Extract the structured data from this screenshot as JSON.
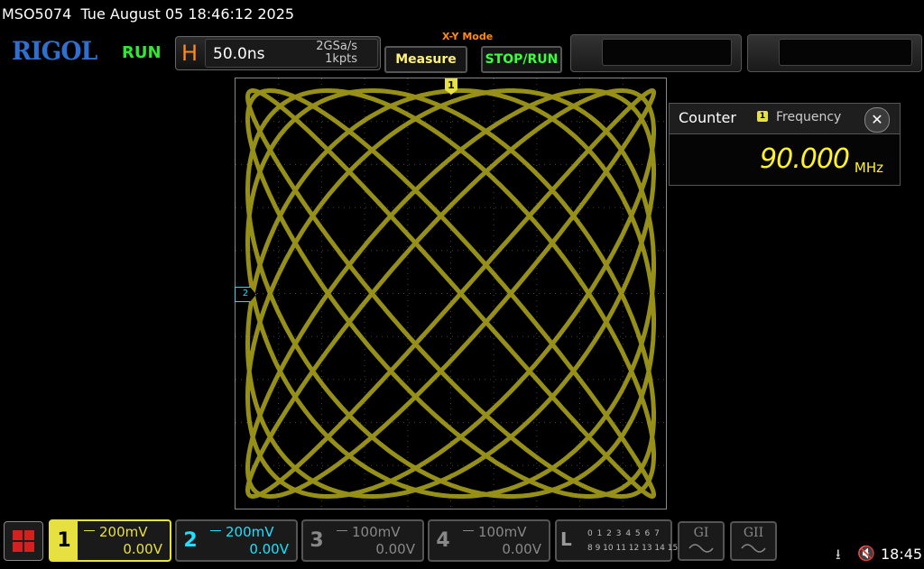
{
  "status": {
    "model": "MSO5074",
    "datetime": "Tue August 05 18:46:12 2025"
  },
  "brand": "RIGOL",
  "run_state": "RUN",
  "horizontal": {
    "letter": "H",
    "timebase": "50.0ns",
    "sample_rate": "2GSa/s",
    "memory_depth": "1kpts"
  },
  "mode_label": "X-Y Mode",
  "buttons": {
    "measure": "Measure",
    "stop_run": "STOP/RUN"
  },
  "markers": {
    "trigger": "1",
    "ch2": "2"
  },
  "counter": {
    "title": "Counter",
    "channel": "1",
    "label": "Frequency",
    "value": "90.000",
    "unit": "MHz",
    "close": "✕"
  },
  "channels": [
    {
      "num": "1",
      "scale": "200mV",
      "offset": "0.00V",
      "color": "#e6e040"
    },
    {
      "num": "2",
      "scale": "200mV",
      "offset": "0.00V",
      "color": "#20e0ff"
    },
    {
      "num": "3",
      "scale": "100mV",
      "offset": "0.00V",
      "color": "#888888"
    },
    {
      "num": "4",
      "scale": "100mV",
      "offset": "0.00V",
      "color": "#888888"
    }
  ],
  "logic": {
    "letter": "L",
    "row1": "0 1 2 3  4 5 6 7",
    "row2": "8 9 10 11 12 13 14 15"
  },
  "generators": {
    "g1": "GI",
    "g2": "GII"
  },
  "tray": {
    "usb": "⭳",
    "speaker": "🔇",
    "clock": "18:45"
  },
  "colors": {
    "trace": "#c8c020",
    "run": "#32e632",
    "accent": "#ff8a1a"
  }
}
